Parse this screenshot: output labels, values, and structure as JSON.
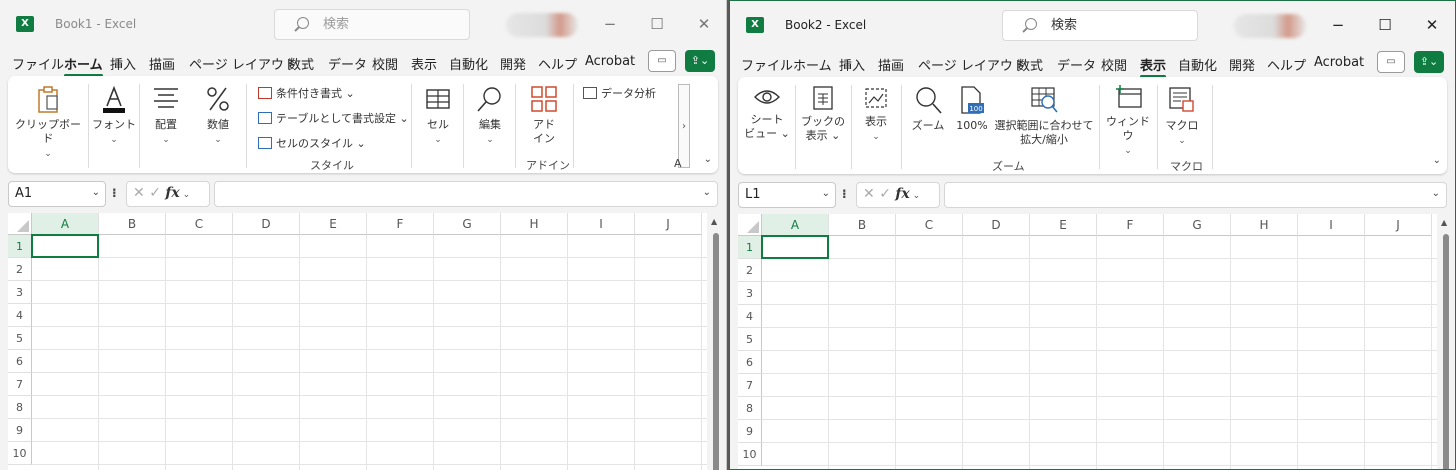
{
  "colors": {
    "accent": "#107c41",
    "window_bg": "#f3f3f3"
  },
  "windows": [
    {
      "title": "Book1  -  Excel",
      "search_text": "検索",
      "menu": [
        "ファイル",
        "ホーム",
        "挿入",
        "描画",
        "ページ レイアウト",
        "数式",
        "データ",
        "校閲",
        "表示",
        "自動化",
        "開発",
        "ヘルプ",
        "Acrobat"
      ],
      "active_tab": "ホーム",
      "ribbon": {
        "clipboard": "クリップボード",
        "font": "フォント",
        "align": "配置",
        "number": "数値",
        "cond_format": "条件付き書式 ⌄",
        "table_format": "テーブルとして書式設定 ⌄",
        "cell_style": "セルのスタイル ⌄",
        "style_group": "スタイル",
        "cells": "セル",
        "edit": "編集",
        "addin_line1": "アド",
        "addin_line2": "イン",
        "addin_group": "アドイン",
        "data_analysis": "データ分析",
        "trailing": "A"
      },
      "name_box": "A1",
      "fx": "fx",
      "columns": [
        "A",
        "B",
        "C",
        "D",
        "E",
        "F",
        "G",
        "H",
        "I",
        "J"
      ],
      "rows": [
        "1",
        "2",
        "3",
        "4",
        "5",
        "6",
        "7",
        "8",
        "9",
        "10"
      ],
      "selected": "A1"
    },
    {
      "title": "Book2  -  Excel",
      "search_text": "検索",
      "menu": [
        "ファイル",
        "ホーム",
        "挿入",
        "描画",
        "ページ レイアウト",
        "数式",
        "データ",
        "校閲",
        "表示",
        "自動化",
        "開発",
        "ヘルプ",
        "Acrobat"
      ],
      "active_tab": "表示",
      "ribbon": {
        "sheet_view_1": "シート",
        "sheet_view_2": "ビュー ⌄",
        "book_view_1": "ブックの",
        "book_view_2": "表示 ⌄",
        "show": "表示",
        "zoom": "ズーム",
        "zoom100": "100%",
        "zoom_sel_1": "選択範囲に合わせて",
        "zoom_sel_2": "拡大/縮小",
        "zoom_group": "ズーム",
        "window": "ウィンドウ",
        "macro": "マクロ",
        "macro_group": "マクロ"
      },
      "name_box": "L1",
      "fx": "fx",
      "columns": [
        "A",
        "B",
        "C",
        "D",
        "E",
        "F",
        "G",
        "H",
        "I",
        "J"
      ],
      "rows": [
        "1",
        "2",
        "3",
        "4",
        "5",
        "6",
        "7",
        "8",
        "9",
        "10"
      ],
      "selected": "A1"
    }
  ]
}
